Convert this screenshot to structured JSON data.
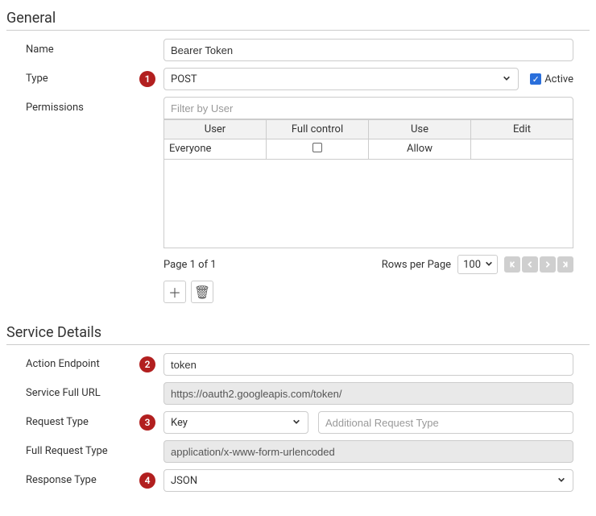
{
  "general": {
    "title": "General",
    "name_label": "Name",
    "name_value": "Bearer Token",
    "type_label": "Type",
    "type_value": "POST",
    "active_label": "Active",
    "active_checked": true,
    "permissions_label": "Permissions",
    "perm_filter_placeholder": "Filter by User",
    "perm_columns": {
      "user": "User",
      "full": "Full control",
      "use": "Use",
      "edit": "Edit"
    },
    "perm_rows": [
      {
        "user": "Everyone",
        "full_checked": false,
        "use": "Allow",
        "edit": ""
      }
    ],
    "page_text": "Page 1 of 1",
    "rows_per_page_label": "Rows per Page",
    "rows_per_page_value": "100"
  },
  "badges": {
    "b1": "1",
    "b2": "2",
    "b3": "3",
    "b4": "4"
  },
  "service": {
    "title": "Service Details",
    "action_endpoint_label": "Action Endpoint",
    "action_endpoint_value": "token",
    "service_url_label": "Service Full URL",
    "service_url_value": "https://oauth2.googleapis.com/token/",
    "request_type_label": "Request Type",
    "request_type_value": "Key",
    "additional_request_placeholder": "Additional Request Type",
    "full_request_label": "Full Request Type",
    "full_request_value": "application/x-www-form-urlencoded",
    "response_type_label": "Response Type",
    "response_type_value": "JSON"
  }
}
